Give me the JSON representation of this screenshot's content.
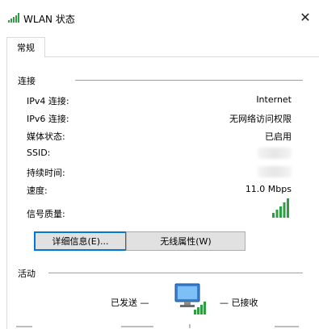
{
  "window": {
    "title": "WLAN 状态",
    "close_glyph": "✕",
    "icon": "wifi-signal-icon"
  },
  "tabs": [
    {
      "label": "常规",
      "active": true
    }
  ],
  "connection": {
    "section_title": "连接",
    "rows": [
      {
        "label": "IPv4 连接:",
        "value": "Internet"
      },
      {
        "label": "IPv6 连接:",
        "value": "无网络访问权限"
      },
      {
        "label": "媒体状态:",
        "value": "已启用"
      },
      {
        "label": "SSID:",
        "value": ""
      },
      {
        "label": "持续时间:",
        "value": ""
      },
      {
        "label": "速度:",
        "value": "11.0 Mbps"
      },
      {
        "label": "信号质量:",
        "value": ""
      }
    ],
    "signal_bars_active": 5,
    "signal_bars_total": 5
  },
  "buttons": {
    "details": "详细信息(E)...",
    "wireless_properties": "无线属性(W)"
  },
  "activity": {
    "section_title": "活动",
    "sent_label": "已发送 —",
    "received_label": "— 已接收"
  },
  "colors": {
    "signal_green": "#2ea043",
    "button_face": "#e1e1e1",
    "focus_border": "#0078d7",
    "separator": "#a0a0a0"
  }
}
